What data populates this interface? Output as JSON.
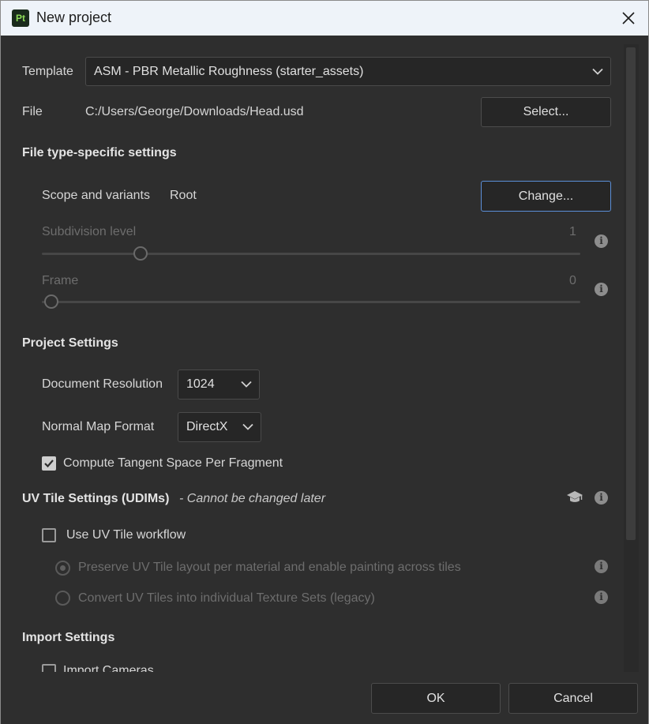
{
  "window": {
    "title": "New project",
    "app_icon_text": "Pt"
  },
  "template": {
    "label": "Template",
    "value": "ASM - PBR Metallic Roughness (starter_assets)"
  },
  "file": {
    "label": "File",
    "path": "C:/Users/George/Downloads/Head.usd",
    "select_label": "Select..."
  },
  "file_type_settings": {
    "heading": "File type-specific settings",
    "scope_label": "Scope and variants",
    "scope_value": "Root",
    "change_label": "Change...",
    "subdivision_label": "Subdivision level",
    "subdivision_value": "1",
    "subdivision_fraction": 0.17,
    "frame_label": "Frame",
    "frame_value": "0",
    "frame_fraction": 0.0
  },
  "project_settings": {
    "heading": "Project Settings",
    "resolution_label": "Document Resolution",
    "resolution_value": "1024",
    "normal_map_label": "Normal Map Format",
    "normal_map_value": "DirectX",
    "tangent_label": "Compute Tangent Space Per Fragment",
    "tangent_checked": true
  },
  "uv_tile_settings": {
    "heading": "UV Tile Settings (UDIMs)",
    "heading_note": "- Cannot be changed later",
    "use_uv_tile_label": "Use UV Tile workflow",
    "use_uv_tile_checked": false,
    "option_preserve": "Preserve UV Tile layout per material and enable painting across tiles",
    "option_convert": "Convert UV Tiles into individual Texture Sets (legacy)",
    "selected_option": "preserve"
  },
  "import_settings": {
    "heading": "Import Settings",
    "import_cameras_label": "Import Cameras"
  },
  "footer": {
    "ok_label": "OK",
    "cancel_label": "Cancel"
  },
  "colors": {
    "background": "#2e2e2e",
    "titlebar": "#eef3f9",
    "focus_border": "#5b8fd8",
    "app_icon_text": "#8fdd5a"
  },
  "icons": [
    "app-icon",
    "close-icon",
    "chevron-down-icon",
    "info-icon",
    "graduation-cap-icon",
    "checkmark-icon"
  ]
}
